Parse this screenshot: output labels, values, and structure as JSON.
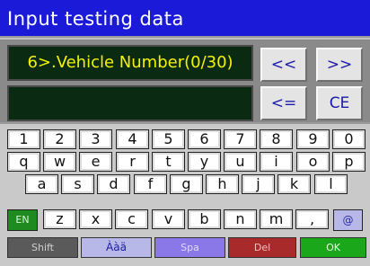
{
  "title": "Input testing data",
  "field_prompt": "6>.Vehicle  Number(0/30)",
  "field_value": "",
  "controls": {
    "left": "<<",
    "right": ">>",
    "backspace": "<=",
    "clear": "CE"
  },
  "keyboard": {
    "row1": [
      "1",
      "2",
      "3",
      "4",
      "5",
      "6",
      "7",
      "8",
      "9",
      "0"
    ],
    "row2": [
      "q",
      "w",
      "e",
      "r",
      "t",
      "y",
      "u",
      "i",
      "o",
      "p"
    ],
    "row3": [
      "a",
      "s",
      "d",
      "f",
      "g",
      "h",
      "j",
      "k",
      "l"
    ],
    "row4": [
      "z",
      "x",
      "c",
      "v",
      "b",
      "n",
      "m",
      ","
    ],
    "lang": "EN",
    "at": "@",
    "shift": "Shift",
    "accent": "Ààä",
    "space": "Spa",
    "delete": "Del",
    "ok": "OK"
  },
  "colors": {
    "title_bar": "#1a1ad8",
    "field_text": "#f4f400",
    "field_bg": "#0a2a12",
    "lang_key": "#1f8a1f",
    "accent_key": "#b8b8e8",
    "space_key": "#8a78e8",
    "delete_key": "#a82a2a",
    "ok_key": "#1aa81a"
  }
}
